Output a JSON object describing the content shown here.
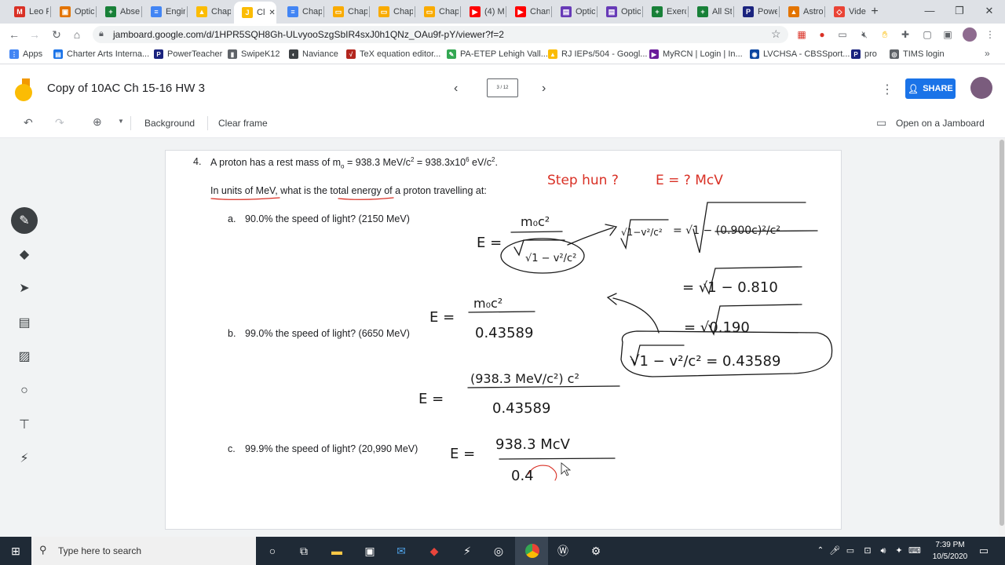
{
  "browser": {
    "tabs": [
      {
        "label": "Leo F",
        "color": "#d93025",
        "glyph": "M"
      },
      {
        "label": "Optic",
        "color": "#e37400",
        "glyph": "▣"
      },
      {
        "label": "Abse",
        "color": "#188038",
        "glyph": "+"
      },
      {
        "label": "Engin",
        "color": "#4285f4",
        "glyph": "≡"
      },
      {
        "label": "Chap",
        "color": "#fbbc04",
        "glyph": "▲"
      },
      {
        "label": "Cl",
        "color": "#fbbc04",
        "glyph": "J"
      },
      {
        "label": "Chap",
        "color": "#4285f4",
        "glyph": "≡"
      },
      {
        "label": "Chap",
        "color": "#f9ab00",
        "glyph": "▭"
      },
      {
        "label": "Chap",
        "color": "#f9ab00",
        "glyph": "▭"
      },
      {
        "label": "Chap",
        "color": "#f9ab00",
        "glyph": "▭"
      },
      {
        "label": "(4) M",
        "color": "#ff0000",
        "glyph": "▶"
      },
      {
        "label": "Chan",
        "color": "#ff0000",
        "glyph": "▶"
      },
      {
        "label": "Optic",
        "color": "#673ab7",
        "glyph": "▤"
      },
      {
        "label": "Optic",
        "color": "#673ab7",
        "glyph": "▤"
      },
      {
        "label": "Exerc",
        "color": "#188038",
        "glyph": "+"
      },
      {
        "label": "All St",
        "color": "#188038",
        "glyph": "+"
      },
      {
        "label": "Powe",
        "color": "#1a237e",
        "glyph": "P"
      },
      {
        "label": "Astro",
        "color": "#e37400",
        "glyph": "▲"
      },
      {
        "label": "Vide",
        "color": "#ea4335",
        "glyph": "◇"
      }
    ],
    "new_tab_label": "+",
    "url": "jamboard.google.com/d/1HPR5SQH8Gh-ULvyooSzgSbIR4sxJ0h1QNz_OAu9f-pY/viewer?f=2",
    "bookmarks": [
      {
        "label": "Apps",
        "color": "#4285f4",
        "glyph": "⋮"
      },
      {
        "label": "Charter Arts Interna...",
        "color": "#1a73e8",
        "glyph": "▤"
      },
      {
        "label": "PowerTeacher",
        "color": "#1a237e",
        "glyph": "P"
      },
      {
        "label": "SwipeK12",
        "color": "#5f6368",
        "glyph": "▮"
      },
      {
        "label": "Naviance",
        "color": "#3c4043",
        "glyph": "◐"
      },
      {
        "label": "TeX equation editor...",
        "color": "#b3261e",
        "glyph": "√"
      },
      {
        "label": "PA-ETEP Lehigh Vall...",
        "color": "#34a853",
        "glyph": "✎"
      },
      {
        "label": "RJ IEPs/504 - Googl...",
        "color": "#fbbc04",
        "glyph": "▲"
      },
      {
        "label": "MyRCN | Login | In...",
        "color": "#6a1b9a",
        "glyph": "▶"
      },
      {
        "label": "LVCHSA - CBSSport...",
        "color": "#0d47a1",
        "glyph": "◉"
      },
      {
        "label": "pro",
        "color": "#1a237e",
        "glyph": "P"
      },
      {
        "label": "TIMS login",
        "color": "#5f6368",
        "glyph": "◎"
      }
    ]
  },
  "app": {
    "title": "Copy of 10AC Ch 15-16 HW 3",
    "frame_counter": "3 / 12",
    "share_label": "SHARE",
    "background_label": "Background",
    "clear_frame_label": "Clear frame",
    "open_on_jamboard_label": "Open on a Jamboard"
  },
  "problem": {
    "number": "4.",
    "mass_text": "A proton has a rest mass of m",
    "mass_sub": "o",
    "mass_text2": " = 938.3 MeV/c",
    "mass_sup": "2",
    "mass_text3": " = 938.3x10",
    "mass_sup2": "6",
    "mass_text4": " eV/c",
    "mass_sup3": "2",
    "mass_text5": ".",
    "question": "In units of MeV, what is the total energy of a proton travelling at:",
    "parts": [
      {
        "letter": "a.",
        "text": "90.0% the speed of light? (2150 MeV)"
      },
      {
        "letter": "b.",
        "text": "99.0% the speed of light? (6650 MeV)"
      },
      {
        "letter": "c.",
        "text": "99.9% the speed of light? (20,990 MeV)"
      }
    ]
  },
  "handwriting": {
    "step_one": "Step hun ?",
    "e_target": "E = ? McV",
    "eq1_lhs": "E =",
    "eq1_num": "m₀c²",
    "eq1_den": "√1 − v²/c²",
    "rhs_top": "= √1 − (0.900c)²/c²",
    "rhs_mid": "= √1 − 0.810",
    "rhs_low": "= √0.190",
    "boxed": "√1 − v²/c² = 0.43589",
    "eq2_lhs": "E =",
    "eq2_num": "m₀c²",
    "eq2_den": "0.43589",
    "eq3_lhs": "E =",
    "eq3_num": "(938.3 MeV/c²) c²",
    "eq3_den": "0.43589",
    "eq4_lhs": "E =",
    "eq4_num": "938.3 McV",
    "eq4_den": "0.4"
  },
  "taskbar": {
    "search_placeholder": "Type here to search",
    "time": "7:39 PM",
    "date": "10/5/2020"
  },
  "colors": {
    "ink_black": "#1a1a1a",
    "ink_red": "#d93025",
    "share_blue": "#1a73e8",
    "jamboard_yellow": "#fbbc04"
  }
}
